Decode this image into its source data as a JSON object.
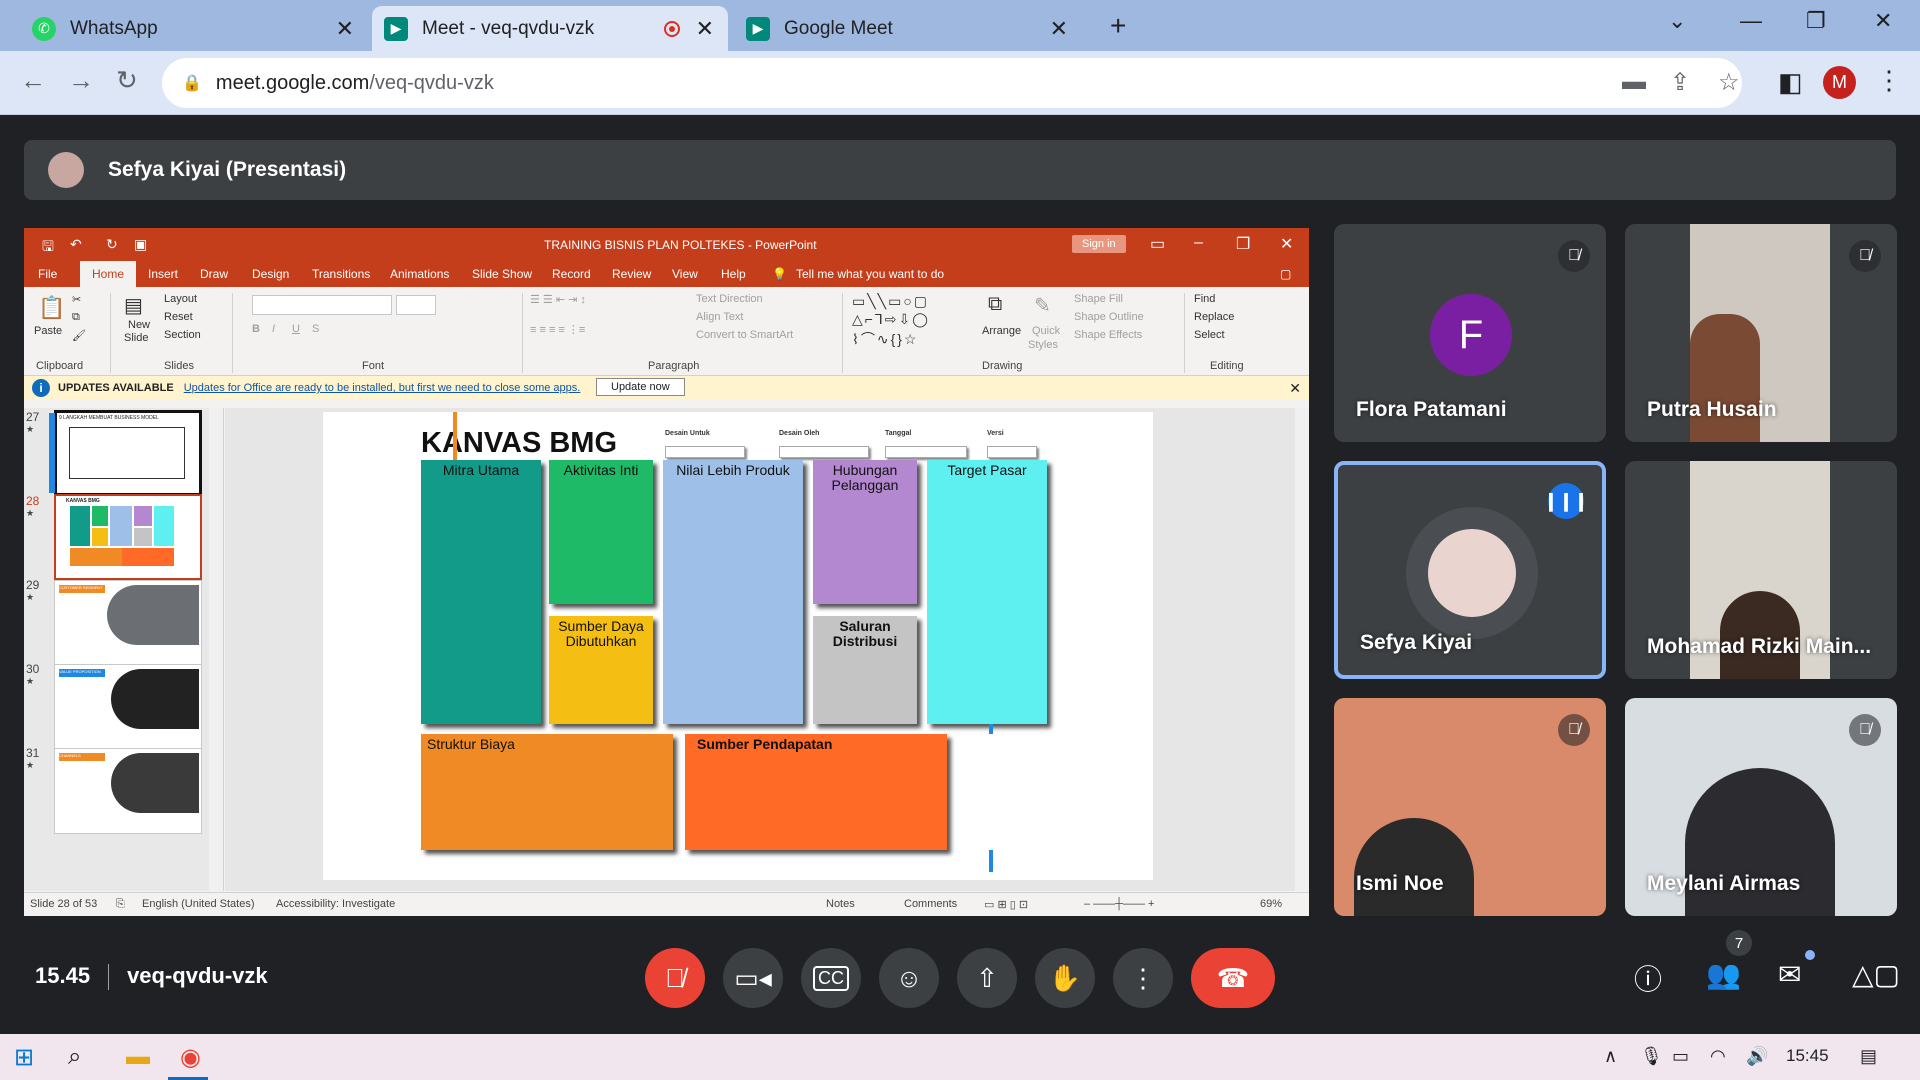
{
  "browser": {
    "tabs": [
      {
        "title": "WhatsApp",
        "icon": "whatsapp-icon"
      },
      {
        "title": "Meet - veq-qvdu-vzk",
        "icon": "meet-icon"
      },
      {
        "title": "Google Meet",
        "icon": "meet-icon"
      }
    ],
    "url_host": "meet.google.com",
    "url_path": "/veq-qvdu-vzk",
    "profile_initial": "M"
  },
  "presentation_bar": {
    "title": "Sefya Kiyai (Presentasi)"
  },
  "powerpoint": {
    "doc_title": "TRAINING BISNIS PLAN POLTEKES - PowerPoint",
    "sign_in": "Sign in",
    "tabs": [
      "File",
      "Home",
      "Insert",
      "Draw",
      "Design",
      "Transitions",
      "Animations",
      "Slide Show",
      "Record",
      "Review",
      "View",
      "Help"
    ],
    "tell_me": "Tell me what you want to do",
    "ribbon": {
      "clipboard": {
        "label": "Clipboard",
        "paste": "Paste"
      },
      "slides": {
        "label": "Slides",
        "new_slide": "New",
        "new_slide2": "Slide",
        "layout": "Layout",
        "reset": "Reset",
        "section": "Section"
      },
      "font": {
        "label": "Font"
      },
      "paragraph": {
        "label": "Paragraph",
        "text_direction": "Text Direction",
        "align_text": "Align Text",
        "smartart": "Convert to SmartArt"
      },
      "drawing": {
        "label": "Drawing",
        "arrange": "Arrange",
        "quick": "Quick",
        "styles": "Styles",
        "shape_fill": "Shape Fill",
        "shape_outline": "Shape Outline",
        "shape_effects": "Shape Effects"
      },
      "editing": {
        "label": "Editing",
        "find": "Find",
        "replace": "Replace",
        "select": "Select"
      }
    },
    "update_bar": {
      "title": "UPDATES AVAILABLE",
      "message": "Updates for Office are ready to be installed, but first we need to close some apps.",
      "button": "Update now"
    },
    "thumbnails": [
      {
        "num": "27",
        "star": "★",
        "caption": "9 LANGKAH MEMBUAT BUSINESS MODEL"
      },
      {
        "num": "28",
        "star": "★",
        "caption": "KANVAS BMG"
      },
      {
        "num": "29",
        "star": "★",
        "caption": "CUSTOMER SEGMENT"
      },
      {
        "num": "30",
        "star": "★",
        "caption": "VALUE PROPOSITION"
      },
      {
        "num": "31",
        "star": "★",
        "caption": "CHANNELS"
      }
    ],
    "slide": {
      "title": "KANVAS BMG",
      "meta": [
        "Desain Untuk",
        "Desain Oleh",
        "Tanggal",
        "Versi"
      ],
      "blocks": {
        "mitra": "Mitra Utama",
        "aktivitas": "Aktivitas Inti",
        "nilai": "Nilai Lebih Produk",
        "hubungan": "Hubungan Pelanggan",
        "target": "Target Pasar",
        "sumber_daya": "Sumber Daya Dibutuhkan",
        "saluran": "Saluran Distribusi",
        "struktur": "Struktur Biaya",
        "pendapatan": "Sumber Pendapatan"
      },
      "colors": {
        "mitra": "#139b8a",
        "aktivitas": "#1fba68",
        "nilai": "#9ec0e8",
        "hubungan": "#b388d0",
        "target": "#5ef0f0",
        "sumber_daya": "#f5be12",
        "saluran": "#c4c4c4",
        "struktur": "#f08a24",
        "pendapatan": "#ff6a26"
      }
    },
    "status": {
      "slide_of": "Slide 28 of 53",
      "language": "English (United States)",
      "accessibility": "Accessibility: Investigate",
      "notes": "Notes",
      "comments": "Comments",
      "zoom": "69%"
    }
  },
  "participants": [
    {
      "name": "Flora Patamani",
      "initial": "F",
      "muted": true,
      "speaking": false
    },
    {
      "name": "Putra Husain",
      "muted": true,
      "speaking": false
    },
    {
      "name": "Sefya Kiyai",
      "muted": false,
      "speaking": true
    },
    {
      "name": "Mohamad Rizki Main...",
      "muted": false,
      "speaking": false
    },
    {
      "name": "Ismi Noe",
      "muted": true,
      "speaking": false
    },
    {
      "name": "Meylani Airmas",
      "muted": true,
      "speaking": false
    }
  ],
  "meeting": {
    "time": "15.45",
    "code": "veq-qvdu-vzk",
    "people_count": "7"
  },
  "taskbar": {
    "clock": "15:45"
  }
}
